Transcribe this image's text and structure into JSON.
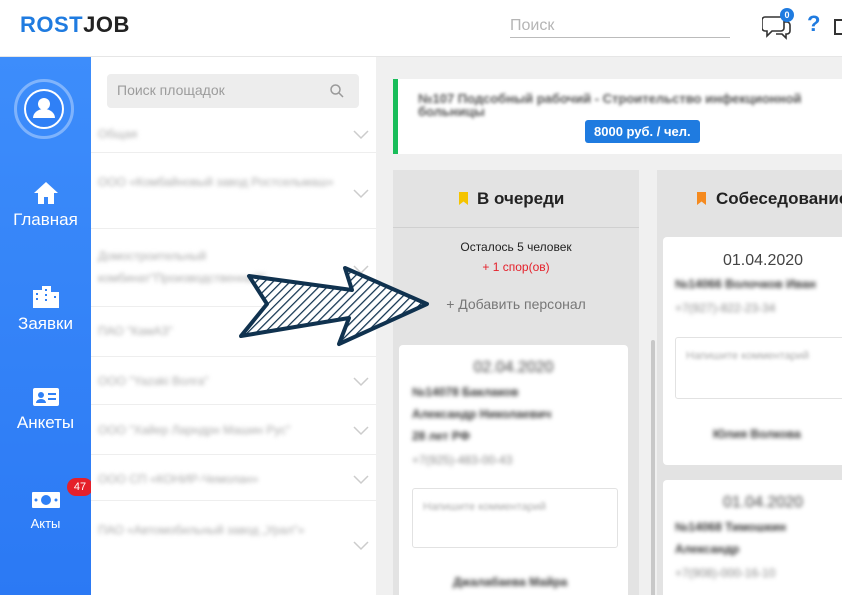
{
  "header": {
    "logo_part1": "ROST",
    "logo_part2": "JOB",
    "search_placeholder": "Поиск",
    "chat_count": "0",
    "help_label": "?"
  },
  "sidebar": {
    "items": [
      {
        "label": "Главная",
        "icon": "home-icon"
      },
      {
        "label": "Заявки",
        "icon": "building-icon"
      },
      {
        "label": "Анкеты",
        "icon": "id-card-icon"
      },
      {
        "label": "Акты",
        "icon": "money-icon",
        "badge": "47"
      }
    ]
  },
  "platforms": {
    "search_placeholder": "Поиск площадок",
    "items": [
      "Общая",
      "ООО «Комбайновый завод Ростсельмаш»",
      "Домостроительный комбинат\"Производственный\"",
      "ПАО \"КамАЗ\"",
      "ООО \"Yazaki Волга\"",
      "ООО \"Хайер Ларндрн Машин Рус\"",
      "ООО СП «КОНИР-Чемолан»",
      "ПАО «Автомобильный завод „Урал\"»"
    ]
  },
  "job": {
    "title": "№107 Подсобный рабочий - Строительство инфекционной больницы",
    "price": "8000 руб. / чел."
  },
  "columns": [
    {
      "name": "В очереди",
      "color": "#f5c400",
      "remaining": "Осталось 5 человек",
      "disputes": "+ 1 спор(ов)",
      "add_label": "+ Добавить персонал",
      "cards": [
        {
          "date": "02.04.2020",
          "line1": "№14078 Баклаков",
          "line2": "Александр Николаевич",
          "line3": "28 лет РФ",
          "phone": "+7(925)-483-00-43",
          "comment_placeholder": "Напишите комментарий",
          "person": "Джалабаева Майра"
        }
      ]
    },
    {
      "name": "Собеседование",
      "color": "#f58a1f",
      "cards": [
        {
          "date": "01.04.2020",
          "line1": "№14066 Волочков Иван",
          "phone": "+7(927)-822-23-34",
          "comment_placeholder": "Напишите комментарий",
          "person": "Юлия Волкова"
        },
        {
          "date": "01.04.2020",
          "line1": "№14068 Тимошкин",
          "line2": "Александр",
          "phone": "+7(908)-000-16-10"
        }
      ]
    }
  ]
}
